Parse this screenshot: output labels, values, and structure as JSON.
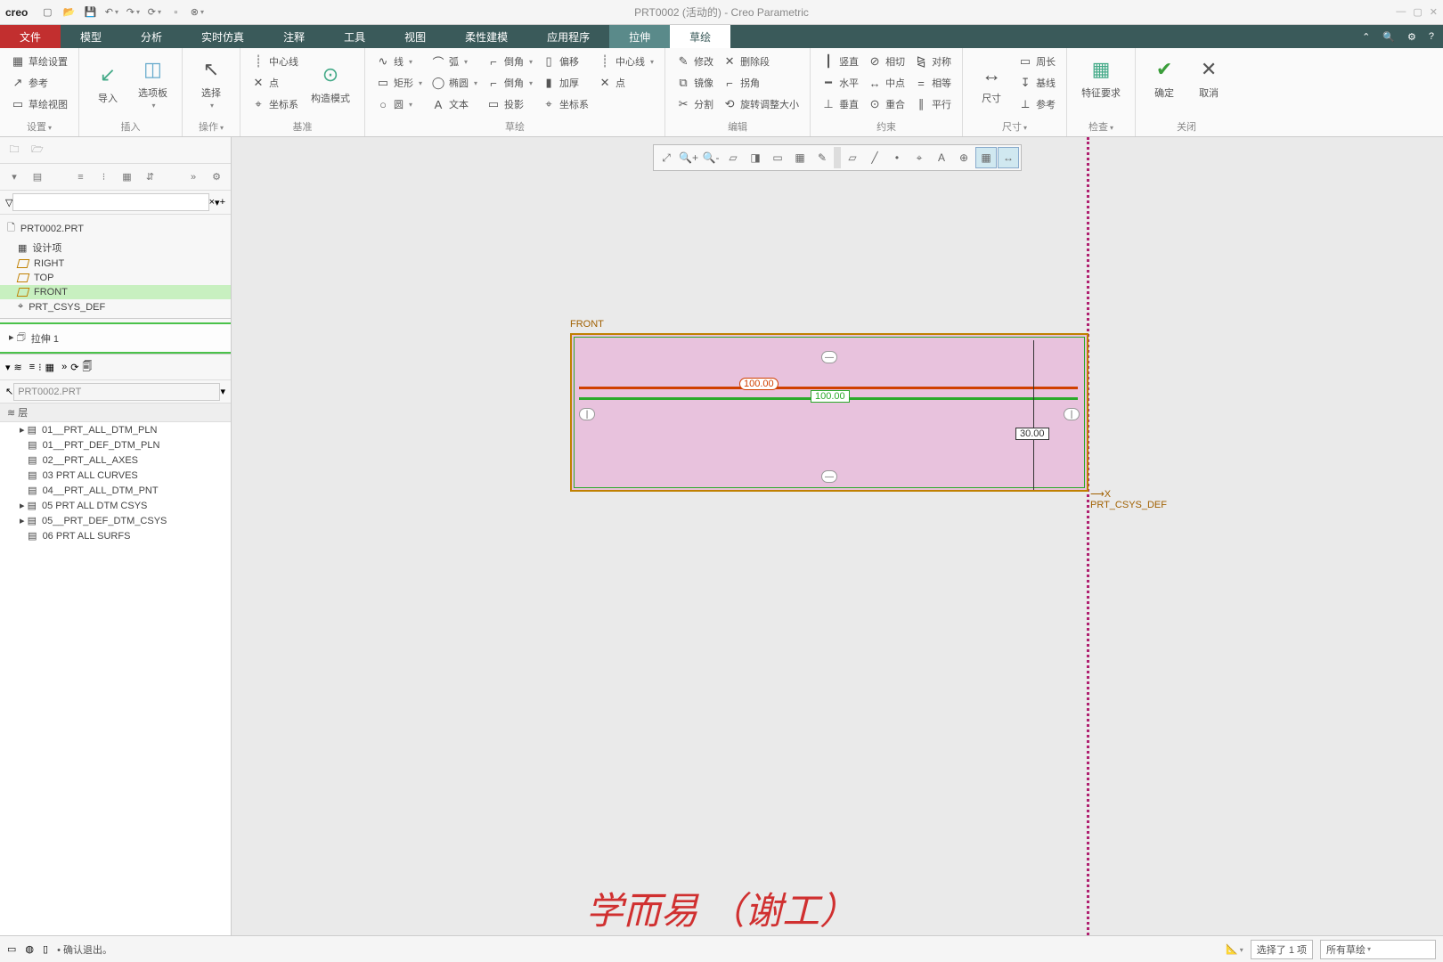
{
  "title": {
    "brand": "creo",
    "center": "PRT0002 (活动的) - Creo Parametric"
  },
  "maintabs": [
    "文件",
    "模型",
    "分析",
    "实时仿真",
    "注释",
    "工具",
    "视图",
    "柔性建模",
    "应用程序",
    "拉伸",
    "草绘"
  ],
  "ribbon": {
    "g1": {
      "label": "设置",
      "items": [
        "草绘设置",
        "参考",
        "草绘视图"
      ]
    },
    "g2": {
      "label": "插入",
      "big1": "导入",
      "big2": "选项板"
    },
    "g3": {
      "label": "操作",
      "big": "选择"
    },
    "g4": {
      "label": "基准",
      "items": [
        "中心线",
        "点",
        "坐标系"
      ],
      "big": "构造模式"
    },
    "g5": {
      "label": "草绘",
      "c1": [
        "线",
        "矩形",
        "圆"
      ],
      "c2": [
        "弧",
        "椭圆",
        "文本"
      ],
      "c3": [
        "倒角",
        "倒角",
        "投影"
      ],
      "c4": [
        "偏移",
        "加厚",
        "坐标系"
      ],
      "c5": [
        "中心线",
        "点",
        ""
      ]
    },
    "g6": {
      "label": "编辑",
      "c1": [
        "修改",
        "镜像",
        "分割"
      ],
      "c2": [
        "删除段",
        "拐角",
        "旋转调整大小"
      ]
    },
    "g7": {
      "label": "约束",
      "c1": [
        "竖直",
        "水平",
        "垂直"
      ],
      "c2": [
        "相切",
        "中点",
        "重合"
      ],
      "c3": [
        "对称",
        "相等",
        "平行"
      ]
    },
    "g8": {
      "label": "尺寸",
      "big": "尺寸",
      "items": [
        "周长",
        "基线",
        "参考"
      ]
    },
    "g9": {
      "label": "检查",
      "big": "特征要求"
    },
    "g10": {
      "label": "关闭",
      "ok": "确定",
      "cancel": "取消"
    }
  },
  "tree": {
    "root": "PRT0002.PRT",
    "items": [
      "设计项",
      "RIGHT",
      "TOP",
      "FRONT",
      "PRT_CSYS_DEF"
    ],
    "extrude": "拉伸 1"
  },
  "lower": {
    "filename": "PRT0002.PRT",
    "header": "层",
    "layers": [
      "01__PRT_ALL_DTM_PLN",
      "01__PRT_DEF_DTM_PLN",
      "02__PRT_ALL_AXES",
      "03   PRT ALL CURVES",
      "04__PRT_ALL_DTM_PNT",
      "05   PRT ALL DTM CSYS",
      "05__PRT_DEF_DTM_CSYS",
      "06   PRT ALL SURFS"
    ]
  },
  "canvas": {
    "front": "FRONT",
    "csys": "PRT_CSYS_DEF",
    "dim_red": "100.00",
    "dim_width": "100.00",
    "dim_height": "30.00"
  },
  "status": {
    "hint": "确认退出。",
    "sel": "选择了 1 项",
    "filter": "所有草绘"
  },
  "watermark": "学而易 （谢工）"
}
